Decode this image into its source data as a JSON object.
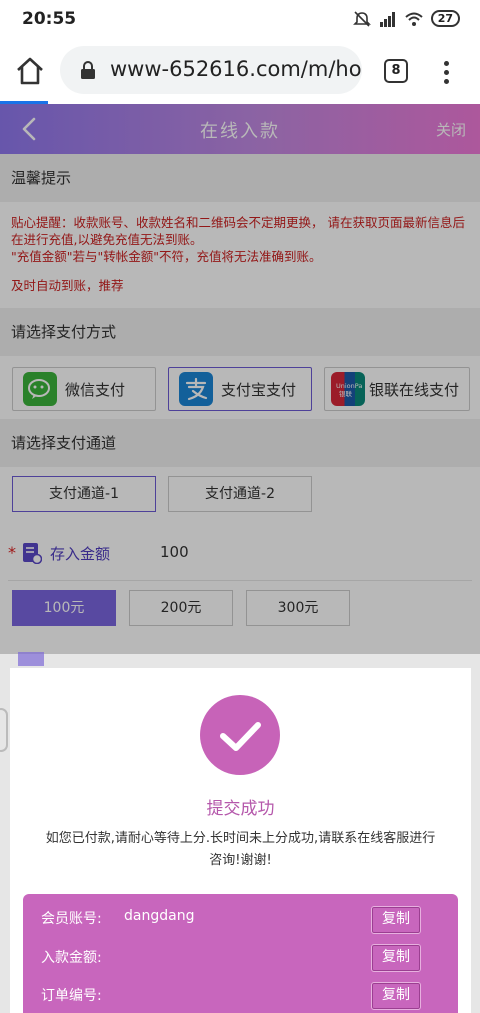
{
  "status_bar": {
    "time": "20:55",
    "battery": "27"
  },
  "browser": {
    "url": "www-652616.com/m/hom",
    "tab_count": "8"
  },
  "header": {
    "title": "在线入款",
    "close_label": "关闭"
  },
  "notice": {
    "heading": "温馨提示",
    "line1": "贴心提醒：收款账号、收款姓名和二维码会不定期更换， 请在获取页面最新信息后在进行充值,以避免充值无法到账。",
    "line2": "\"充值金额\"若与\"转帐金额\"不符，充值将无法准确到账。",
    "line3": "及时自动到账，推荐"
  },
  "payment": {
    "heading": "请选择支付方式",
    "methods": [
      {
        "label": "微信支付",
        "icon": "wechat-icon"
      },
      {
        "label": "支付宝支付",
        "icon": "alipay-icon"
      },
      {
        "label": "银联在线支付",
        "icon": "unionpay-icon"
      }
    ],
    "selected": 1
  },
  "channel": {
    "heading": "请选择支付通道",
    "options": [
      "支付通道-1",
      "支付通道-2"
    ],
    "selected": 0
  },
  "amount": {
    "label": "存入金额",
    "value": "100",
    "quick": [
      "100元",
      "200元",
      "300元"
    ],
    "selected": 0
  },
  "modal": {
    "title": "提交成功",
    "message": "如您已付款,请耐心等待上分.长时间未上分成功,请联系在线客服进行咨询!谢谢!",
    "rows": [
      {
        "label": "会员账号:",
        "value": "dangdang",
        "copy": "复制"
      },
      {
        "label": "入款金额:",
        "value": "",
        "copy": "复制"
      },
      {
        "label": "订单编号:",
        "value": "",
        "copy": "复制"
      }
    ]
  },
  "colors": {
    "accent": "#7b66e0",
    "modal_accent": "#c866bd",
    "notice_red": "#cc2222"
  }
}
